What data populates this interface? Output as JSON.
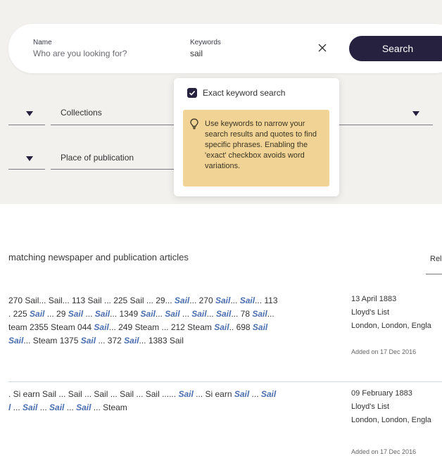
{
  "search": {
    "name_label": "Name",
    "name_placeholder": "Who are you looking for?",
    "keywords_label": "Keywords",
    "keywords_value": "sail",
    "search_button": "Search"
  },
  "filters": {
    "collections": "Collections",
    "place": "Place of publication"
  },
  "popup": {
    "exact_label": "Exact keyword search",
    "exact_checked": true,
    "tip": "Use keywords to narrow your search results and quotes to find specific phrases. Enabling the 'exact' checkbox avoids word variations."
  },
  "results": {
    "header": "matching newspaper and publication articles",
    "sort_label": "Rel",
    "items": [
      {
        "snippet_lines": [
          "270 Sail... Sail... 113 Sail ... 225 Sail ... 29... <b>Sail</b>... 270 <b>Sail</b>... <b>Sail</b>... 113",
          ". 225 <b>Sail</b> ... 29 <b>Sail</b> ... <b>Sail</b>... 1349 <b>Sail</b>... <b>Sail</b> ... <b>Sail</b>... <b>Sail</b>... 78 <b>Sail</b>...",
          "team 2355 Steam 044 <b>Sail</b>... 249 Steam ... 212 Steam <b>Sail</b>.. 698 <b>Sail</b>",
          "<b>Sail</b>... Steam 1375 <b>Sail</b> ... 372 <b>Sail</b>... 1383 Sail"
        ],
        "date": "13 April 1883",
        "publication": "Lloyd's List",
        "place": "London, London, Engla",
        "added": "Added on 17 Dec 2016"
      },
      {
        "snippet_lines": [
          ". Si earn Sail ... Sail ... Sail ... Sail ... Sail ...... <b>Sail</b> ... Si earn <b>Sail</b> ... <b>Sail</b>",
          "<b>l</b> ... <b>Sail</b> ... <b>Sail</b> ... <b>Sail</b> ... Steam"
        ],
        "date": "09 February 1883",
        "publication": "Lloyd's List",
        "place": "London, London, Engla",
        "added": "Added on 17 Dec 2016"
      }
    ]
  },
  "colors": {
    "primary": "#25213f",
    "band": "#f3f1ee",
    "tip": "#f1d495",
    "highlight": "#4c6fb0"
  }
}
